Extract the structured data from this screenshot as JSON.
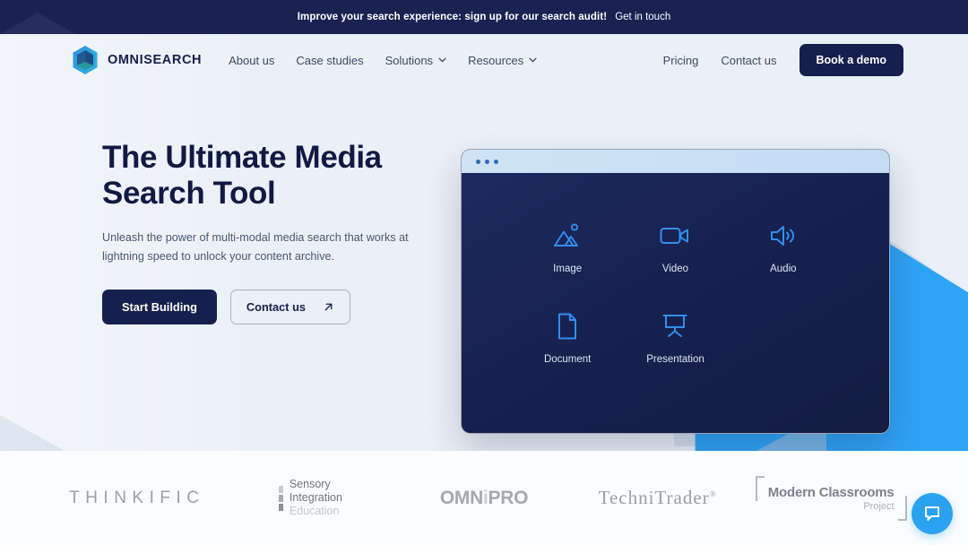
{
  "announcement": {
    "text": "Improve your search experience: sign up for our search audit!",
    "link_label": "Get in touch"
  },
  "nav": {
    "brand": "OMNISEARCH",
    "links": [
      {
        "label": "About us",
        "has_dropdown": false
      },
      {
        "label": "Case studies",
        "has_dropdown": false
      },
      {
        "label": "Solutions",
        "has_dropdown": true
      },
      {
        "label": "Resources",
        "has_dropdown": true
      }
    ],
    "right_links": [
      {
        "label": "Pricing"
      },
      {
        "label": "Contact us"
      }
    ],
    "cta_label": "Book a demo"
  },
  "hero": {
    "title_line1": "The Ultimate Media",
    "title_line2": "Search Tool",
    "subtitle": "Unleash the power of multi-modal media search that works at lightning speed to unlock your content archive.",
    "primary_cta": "Start Building",
    "secondary_cta": "Contact us"
  },
  "panel": {
    "media_types_row1": [
      {
        "label": "Image",
        "icon": "image-icon"
      },
      {
        "label": "Video",
        "icon": "video-icon"
      },
      {
        "label": "Audio",
        "icon": "audio-icon"
      }
    ],
    "media_types_row2": [
      {
        "label": "Document",
        "icon": "document-icon"
      },
      {
        "label": "Presentation",
        "icon": "presentation-icon"
      }
    ]
  },
  "logos": [
    {
      "name": "THINKIFIC"
    },
    {
      "line1": "Sensory",
      "line2": "Integration",
      "line3": "Education"
    },
    {
      "pre": "OMN",
      "tick": "i",
      "post": "PRO"
    },
    {
      "name": "TechniTrader",
      "mark": "®"
    },
    {
      "line1": "Modern Classrooms",
      "line2": "Project"
    }
  ],
  "colors": {
    "brand_navy": "#16204d",
    "accent_blue": "#2fa3f5",
    "hero_bg": "#eaf0f7",
    "chat_blue": "#29a3ef"
  }
}
